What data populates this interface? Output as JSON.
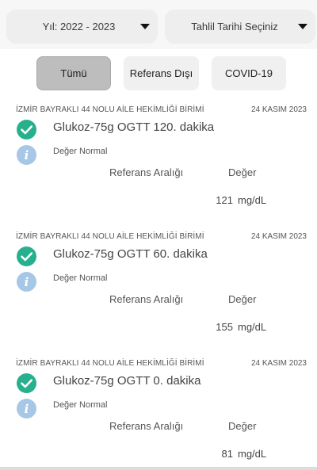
{
  "filters": {
    "year_dropdown": "Yıl: 2022 - 2023",
    "date_dropdown": "Tahlil Tarihi Seçiniz",
    "tabs": [
      {
        "label": "Tümü",
        "active": true
      },
      {
        "label": "Referans Dışı",
        "active": false
      },
      {
        "label": "COVID-19",
        "active": false
      }
    ]
  },
  "records": [
    {
      "clinic": "İZMİR BAYRAKLI 44 NOLU AİLE HEKİMLİĞİ BİRİMİ",
      "date": "24 KASIM 2023",
      "test": "Glukoz-75g OGTT 120. dakika",
      "status": "Değer Normal",
      "ref_header": "Referans Aralığı",
      "value_header": "Değer",
      "value": "121",
      "unit": "mg/dL"
    },
    {
      "clinic": "İZMİR BAYRAKLI 44 NOLU AİLE HEKİMLİĞİ BİRİMİ",
      "date": "24 KASIM 2023",
      "test": "Glukoz-75g OGTT 60. dakika",
      "status": "Değer Normal",
      "ref_header": "Referans Aralığı",
      "value_header": "Değer",
      "value": "155",
      "unit": "mg/dL"
    },
    {
      "clinic": "İZMİR BAYRAKLI 44 NOLU AİLE HEKİMLİĞİ BİRİMİ",
      "date": "24 KASIM 2023",
      "test": "Glukoz-75g OGTT 0. dakika",
      "status": "Değer Normal",
      "ref_header": "Referans Aralığı",
      "value_header": "Değer",
      "value": "81",
      "unit": "mg/dL"
    }
  ],
  "icons": {
    "status": "check-circle-icon",
    "info": "info-icon",
    "dropdown": "caret-down-icon"
  },
  "colors": {
    "check": "#27b08d",
    "info": "#a6c7e6",
    "active_tab": "#bdbdbd"
  }
}
